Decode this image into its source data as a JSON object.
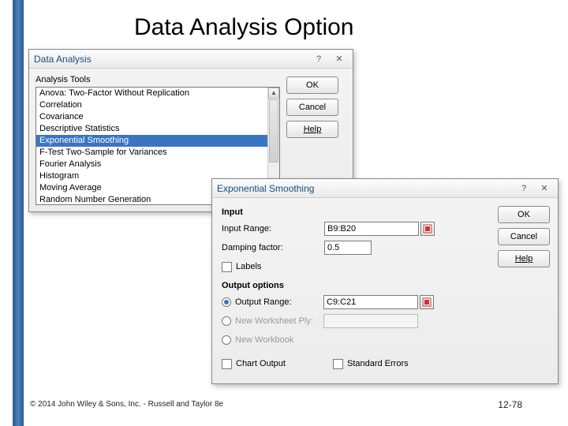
{
  "slide": {
    "title": "Data Analysis Option",
    "footer_left": "© 2014 John Wiley & Sons, Inc. - Russell and Taylor 8e",
    "footer_right": "12-78"
  },
  "da_dialog": {
    "title": "Data Analysis",
    "group_label": "Analysis Tools",
    "items": [
      "Anova: Two-Factor Without Replication",
      "Correlation",
      "Covariance",
      "Descriptive Statistics",
      "Exponential Smoothing",
      "F-Test Two-Sample for Variances",
      "Fourier Analysis",
      "Histogram",
      "Moving Average",
      "Random Number Generation"
    ],
    "selected_index": 4,
    "buttons": {
      "ok": "OK",
      "cancel": "Cancel",
      "help": "Help"
    }
  },
  "es_dialog": {
    "title": "Exponential Smoothing",
    "section_input": "Input",
    "input_range_label": "Input Range:",
    "input_range_value": "B9:B20",
    "damping_label": "Damping factor:",
    "damping_value": "0.5",
    "labels_chk": "Labels",
    "section_output": "Output options",
    "output_range_label": "Output Range:",
    "output_range_value": "C9:C21",
    "new_ws_label": "New Worksheet Ply:",
    "new_wb_label": "New Workbook",
    "chart_output": "Chart Output",
    "std_errors": "Standard Errors",
    "buttons": {
      "ok": "OK",
      "cancel": "Cancel",
      "help": "Help"
    }
  },
  "icons": {
    "help": "?",
    "close": "✕",
    "up": "▲",
    "down": "▼"
  }
}
